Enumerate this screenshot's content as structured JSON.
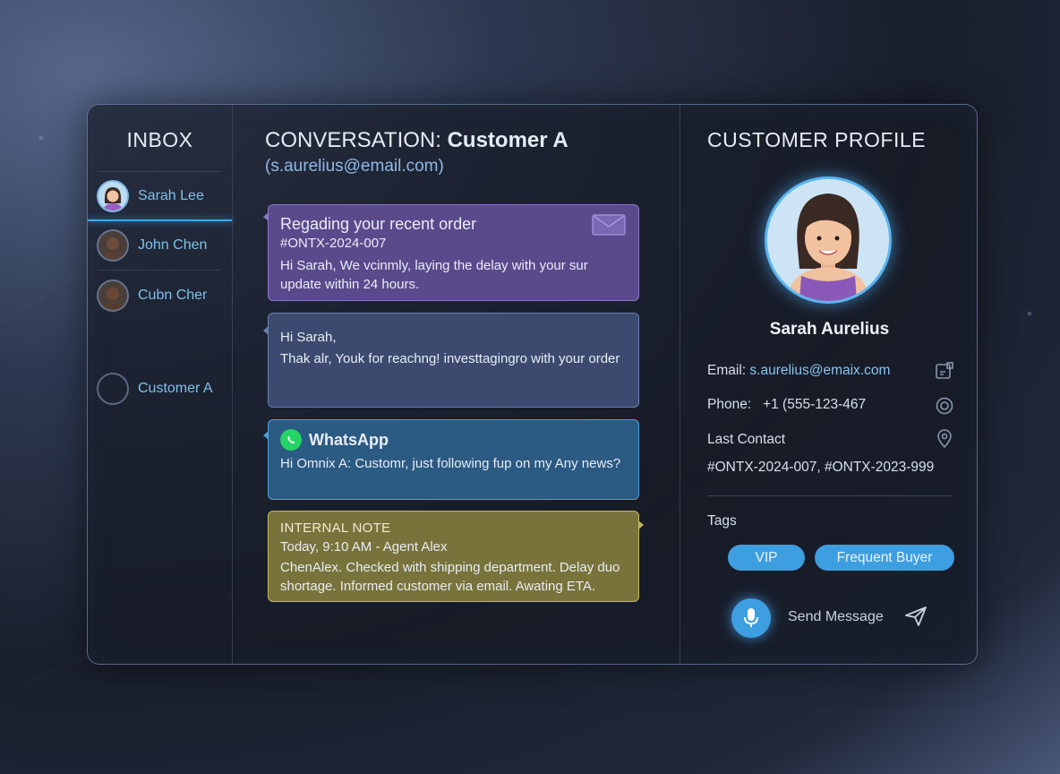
{
  "inbox": {
    "title": "INBOX",
    "items": [
      {
        "name": "Sarah Lee"
      },
      {
        "name": "John Chen"
      },
      {
        "name": "Cubn Cher"
      },
      {
        "name": "Customer A"
      }
    ]
  },
  "conversation": {
    "title_prefix": "CONVERSATION:",
    "title_name": "Customer A",
    "email": "(s.aurelius@email.com)",
    "messages": [
      {
        "subject": "Regading your recent order",
        "order": "#ONTX-2024-007",
        "body": "Hi Sarah, We vcinmly, laying the delay with your sur update within 24 hours."
      },
      {
        "greeting": "Hi Sarah,",
        "body": "Thak alr, Youk for reachng! investtagingro with your order"
      },
      {
        "channel": "WhatsApp",
        "body": "Hi Omnix A: Customr, just following fup on my Any news?"
      },
      {
        "label": "INTERNAL NOTE",
        "meta": "Today, 9:10 AM - Agent Alex",
        "body": "ChenAlex. Checked with shipping department. Delay duo shortage. Informed customer via email. Awating ETA."
      }
    ]
  },
  "profile": {
    "title": "CUSTOMER PROFILE",
    "name": "Sarah Aurelius",
    "email_label": "Email:",
    "email_value": "s.aurelius@emaix.com",
    "phone_label": "Phone:",
    "phone_value": "+1 (555-123-467",
    "last_contact_label": "Last Contact",
    "orders": "#ONTX-2024-007, #ONTX-2023-999",
    "tags_label": "Tags",
    "tags": [
      "VIP",
      "Frequent Buyer"
    ],
    "send_label": "Send Message"
  },
  "icons": {
    "mail": "envelope-icon",
    "whatsapp": "whatsapp-icon",
    "mic": "microphone-icon",
    "send": "paper-plane-icon",
    "email_action": "edit-icon",
    "phone_action": "target-icon",
    "location_action": "location-pin-icon"
  },
  "colors": {
    "accent": "#3d9ee0",
    "email_bubble": "#5a4a8c",
    "message_bubble": "#3b4a6e",
    "whatsapp_bubble": "#2b5a82",
    "note_bubble": "#78733a"
  }
}
